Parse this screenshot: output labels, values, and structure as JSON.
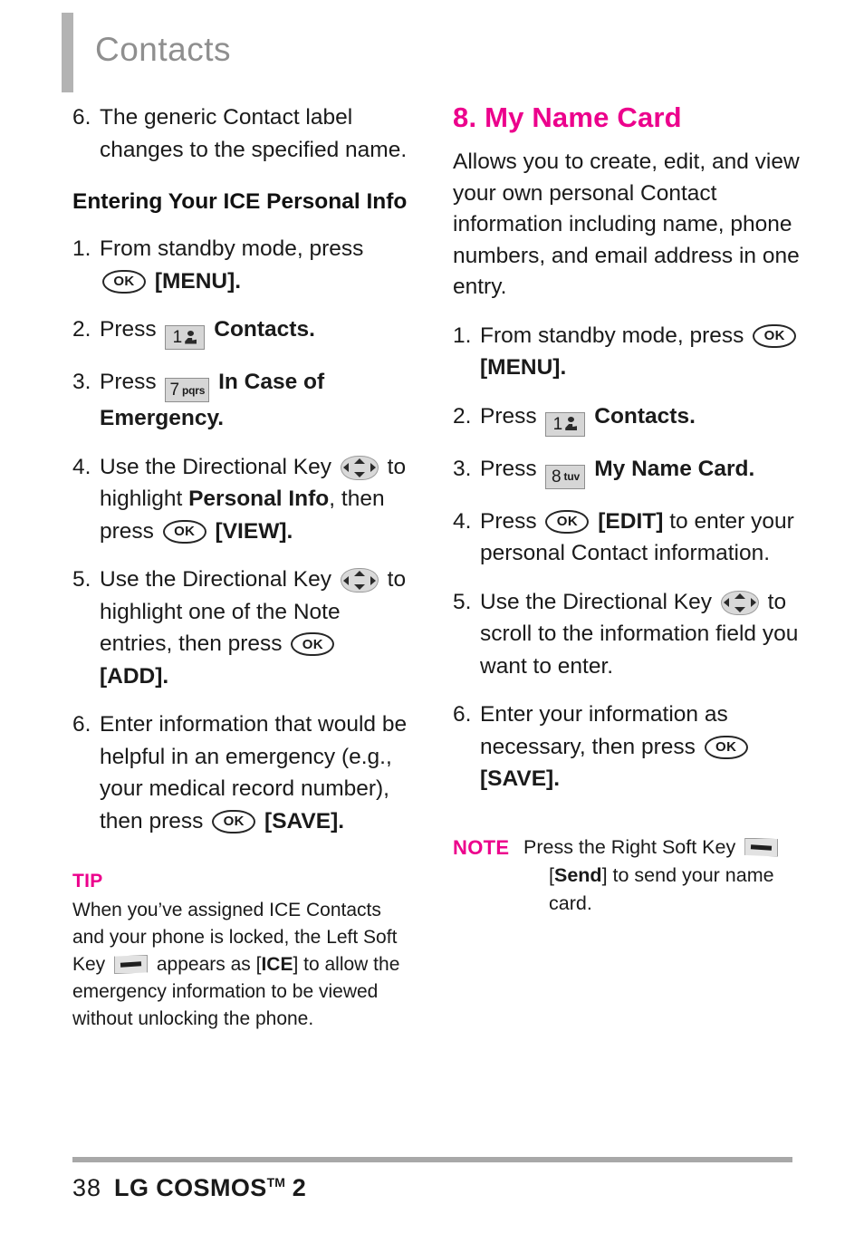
{
  "header": {
    "chapter_title": "Contacts"
  },
  "left_column": {
    "continued_step": {
      "num": "6.",
      "text": "The generic Contact label changes to the specified name."
    },
    "sub_heading": "Entering Your ICE Personal Info",
    "steps": [
      {
        "num": "1.",
        "pre": "From standby mode, press",
        "key": "OK",
        "post": "[MENU]."
      },
      {
        "num": "2.",
        "pre": "Press",
        "key": "1",
        "post": "Contacts."
      },
      {
        "num": "3.",
        "pre": "Press",
        "key": "7",
        "key_letters": "pqrs",
        "post": "In Case of Emergency."
      },
      {
        "num": "4.",
        "pre": "Use the Directional Key",
        "key": "directional",
        "post": "to highlight",
        "bold": "Personal Info",
        "post2": ", then press",
        "key2": "OK",
        "post3": "[VIEW]."
      },
      {
        "num": "5.",
        "pre": "Use the Directional Key",
        "key": "directional",
        "post": "to highlight one of the Note entries, then press",
        "key2": "OK",
        "post3": "[ADD]."
      },
      {
        "num": "6.",
        "pre": "Enter information that would be helpful in an emergency (e.g., your medical record number), then press",
        "key2": "OK",
        "post3": "[SAVE]."
      }
    ],
    "tip": {
      "label": "TIP",
      "part1": "When you’ve assigned ICE Contacts and your phone is locked, the Left Soft Key",
      "key": "left-soft-key",
      "part2": "appears as [",
      "bold": "ICE",
      "part3": "] to allow the emergency information to be viewed without unlocking the phone."
    }
  },
  "right_column": {
    "section_heading": "8. My Name Card",
    "intro": "Allows you to create, edit, and view your own personal Contact information including name, phone numbers, and email address in one entry.",
    "steps": [
      {
        "num": "1.",
        "pre": "From standby mode, press",
        "key": "OK",
        "post": "[MENU]."
      },
      {
        "num": "2.",
        "pre": "Press",
        "key": "1",
        "post": "Contacts."
      },
      {
        "num": "3.",
        "pre": "Press",
        "key": "8",
        "key_letters": "tuv",
        "post": "My Name Card."
      },
      {
        "num": "4.",
        "pre": "Press",
        "key": "OK",
        "post_bold": "[EDIT]",
        "post": "to enter your personal Contact information."
      },
      {
        "num": "5.",
        "pre": "Use the Directional Key",
        "key": "directional",
        "post": "to scroll to the information field you want to enter."
      },
      {
        "num": "6.",
        "pre": "Enter your information as necessary, then press",
        "key": "OK",
        "post": "[SAVE]."
      }
    ],
    "note": {
      "label": "NOTE",
      "part1": "Press the Right Soft Key",
      "key": "right-soft-key",
      "part2": "[",
      "bold": "Send",
      "part3": "] to send your name card."
    }
  },
  "footer": {
    "page_number": "38",
    "model_name": "LG COSMOS",
    "model_tm": "TM",
    "model_version": "2"
  },
  "colors": {
    "accent_magenta": "#ec008c",
    "chapter_gray": "#8f8f8f",
    "rule_gray": "#a8a8a8"
  }
}
